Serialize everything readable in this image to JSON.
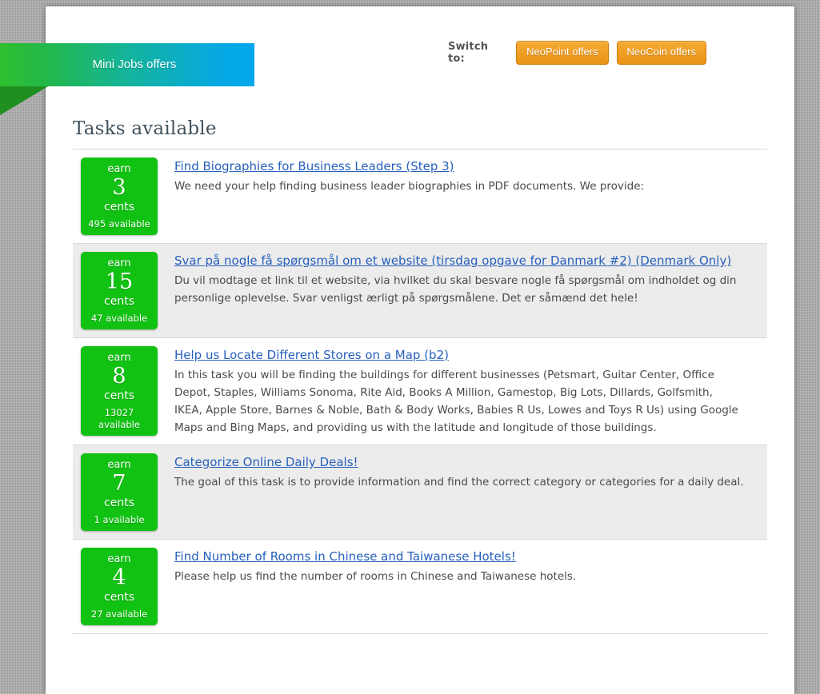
{
  "ribbon": {
    "label": "Mini Jobs offers"
  },
  "header": {
    "switch_label": "Switch to:",
    "buttons": [
      {
        "label": "NeoPoint offers"
      },
      {
        "label": "NeoCoin offers"
      }
    ]
  },
  "main": {
    "title": "Tasks available",
    "badge_earn_label": "earn",
    "badge_unit_label": "cents",
    "tasks": [
      {
        "amount": "3",
        "available": "495 available",
        "title": "Find Biographies for Business Leaders (Step 3)",
        "description": "We need your help finding business leader biographies in PDF documents. We provide:"
      },
      {
        "amount": "15",
        "available": "47 available",
        "title": "Svar på nogle få spørgsmål om et website (tirsdag opgave for Danmark #2) (Denmark Only)",
        "description": "Du vil modtage et link til et website, via hvilket du skal besvare nogle få spørgsmål om indholdet og din personlige oplevelse. Svar venligst ærligt på spørgsmålene. Det er såmænd det hele!"
      },
      {
        "amount": "8",
        "available": "13027 available",
        "title": "Help us Locate Different Stores on a Map (b2)",
        "description": "In this task you will be finding the buildings for different businesses (Petsmart, Guitar Center, Office Depot, Staples, Williams Sonoma, Rite Aid, Books A Million, Gamestop, Big Lots, Dillards, Golfsmith, IKEA, Apple Store, Barnes & Noble, Bath & Body Works, Babies R Us, Lowes and Toys R Us) using Google Maps and Bing Maps, and providing us with the latitude and longitude of those buildings."
      },
      {
        "amount": "7",
        "available": "1 available",
        "title": "Categorize Online Daily Deals!",
        "description": "The goal of this task is to provide information and find the correct category or categories for a daily deal."
      },
      {
        "amount": "4",
        "available": "27 available",
        "title": "Find Number of Rooms in Chinese and Taiwanese Hotels!",
        "description": "Please help us find the number of rooms in Chinese and Taiwanese hotels."
      }
    ]
  },
  "colors": {
    "badge_green": "#11c212",
    "link_blue": "#2760bd",
    "button_orange": "#f0a027",
    "ribbon_green": "#2fbf2f",
    "ribbon_blue": "#01a8ed"
  }
}
